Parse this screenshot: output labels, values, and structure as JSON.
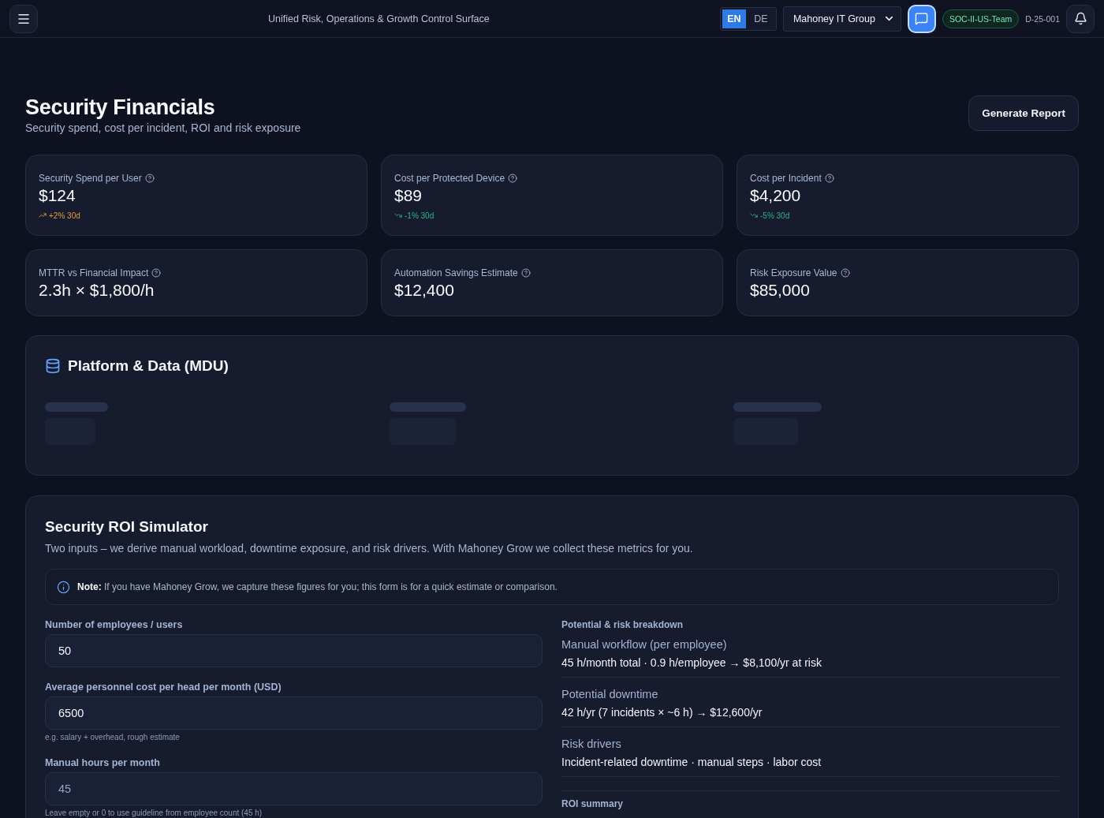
{
  "top_bar": {
    "title": "Unified Risk, Operations & Growth Control Surface",
    "languages": [
      {
        "label": "EN",
        "selected": true
      },
      {
        "label": "DE",
        "selected": false
      }
    ],
    "organization_select": {
      "value": "Mahoney IT Group"
    },
    "chat_button": {
      "active": true
    },
    "team_badge": "SOC-II-US-Team",
    "document_id": "D-25-001"
  },
  "header": {
    "title": "Security Financials",
    "subtitle": "Security spend, cost per incident, ROI and risk exposure",
    "action": "Generate Report"
  },
  "kpi_cards": [
    {
      "label": "Security Spend per User",
      "value": "$124",
      "trend": {
        "text": "+2% 30d",
        "rising": true
      }
    },
    {
      "label": "Cost per Protected Device",
      "value": "$89",
      "trend": {
        "text": "-1% 30d",
        "rising": false
      }
    },
    {
      "label": "Cost per Incident",
      "value": "$4,200",
      "trend": {
        "text": "-5% 30d",
        "rising": false
      }
    },
    {
      "label": "MTTR vs Financial Impact",
      "value": "2.3h × $1,800/h"
    },
    {
      "label": "Automation Savings Estimate",
      "value": "$12,400"
    },
    {
      "label": "Risk Exposure Value",
      "value": "$85,000"
    }
  ],
  "platform_section": {
    "title": "Platform & Data (MDU)",
    "loading": true
  },
  "roi_simulator": {
    "title": "Security ROI Simulator",
    "description": "Two inputs – we derive manual workload, downtime exposure, and risk drivers. With Mahoney Grow we collect these metrics for you.",
    "note": "**Note:** If you have Mahoney Grow, we capture these figures for you; this form is for a quick estimate or comparison.",
    "fields": [
      {
        "label": "Number of employees / users",
        "value": "50"
      },
      {
        "label": "Average personnel cost per head per month (USD)",
        "value": "6500",
        "hint": "e.g. salary + overhead, rough estimate"
      },
      {
        "label": "Manual hours per month",
        "placeholder": "45",
        "hint": "Leave empty or 0 to use guideline from employee count (45 h)"
      }
    ],
    "breakdown": {
      "title": "Potential & risk breakdown",
      "items": [
        {
          "title": "Manual workflow (per employee)",
          "text": "45 h/month total · 0.9 h/employee → $8,100/yr at risk"
        },
        {
          "title": "Potential downtime",
          "text": "42 h/yr (7 incidents × ~6 h) → $12,600/yr"
        },
        {
          "title": "Risk drivers",
          "text": "Incident-related downtime · manual steps · labor cost"
        }
      ]
    },
    "summary": {
      "title": "ROI summary"
    }
  }
}
